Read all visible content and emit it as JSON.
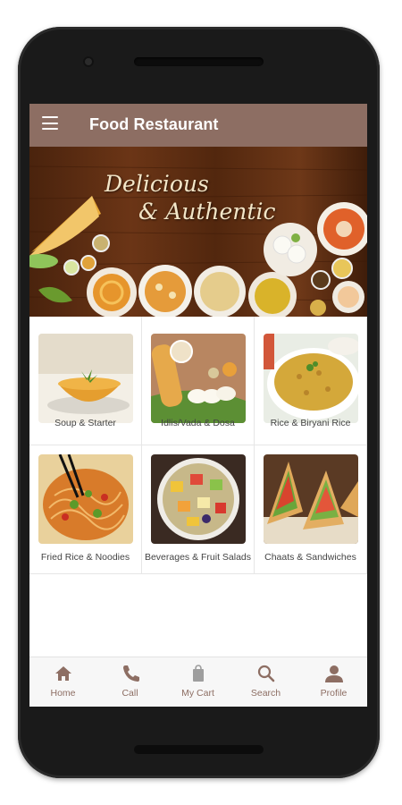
{
  "app": {
    "title": "Food Restaurant"
  },
  "banner": {
    "line1": "Delicious",
    "line2": "& Authentic"
  },
  "categories": [
    {
      "label": "Soup & Starter",
      "image": "soup-image"
    },
    {
      "label": "Idlis/Vada & Dosa",
      "image": "dosa-idli-image"
    },
    {
      "label": "Rice & Biryani Rice",
      "image": "biryani-image"
    },
    {
      "label": "Fried Rice & Noodies",
      "image": "noodles-image"
    },
    {
      "label": "Beverages & Fruit Salads",
      "image": "fruit-salad-image"
    },
    {
      "label": "Chaats & Sandwiches",
      "image": "sandwich-image"
    }
  ],
  "nav": [
    {
      "label": "Home",
      "icon": "home-icon"
    },
    {
      "label": "Call",
      "icon": "phone-icon"
    },
    {
      "label": "My Cart",
      "icon": "cart-icon"
    },
    {
      "label": "Search",
      "icon": "search-icon"
    },
    {
      "label": "Profile",
      "icon": "profile-icon"
    }
  ],
  "colors": {
    "appbar": "#8d6e63",
    "nav_accent": "#8d6e63",
    "banner_wood": "#5a2d12"
  }
}
